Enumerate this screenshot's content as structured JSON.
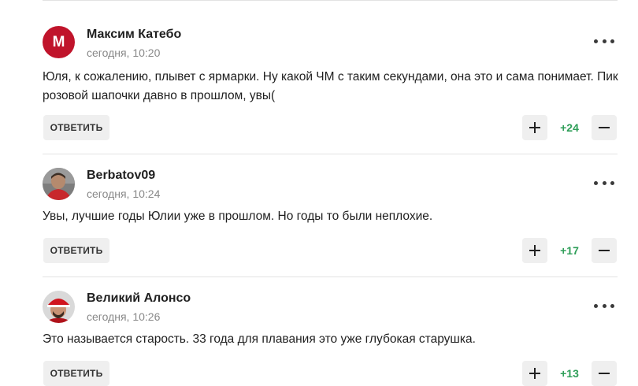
{
  "reply_label": "ОТВЕТИТЬ",
  "accent_color": "#2e9e58",
  "comments": [
    {
      "author": "Максим Катебо",
      "avatar_letter": "M",
      "avatar_color": "#c0142b",
      "time": "сегодня, 10:20",
      "text": "Юля, к сожалению, плывет с ярмарки. Ну какой ЧМ с таким секундами, она это и сама понимает. Пик розовой шапочки давно в прошлом, увы(",
      "score": "+24"
    },
    {
      "author": "Berbatov09",
      "time": "сегодня, 10:24",
      "text": "Увы, лучшие годы Юлии уже в прошлом. Но годы то были неплохие.",
      "score": "+17"
    },
    {
      "author": "Великий Алонсо",
      "time": "сегодня, 10:26",
      "text": "Это называется старость. 33 года для плавания это уже глубокая старушка.",
      "score": "+13"
    }
  ]
}
